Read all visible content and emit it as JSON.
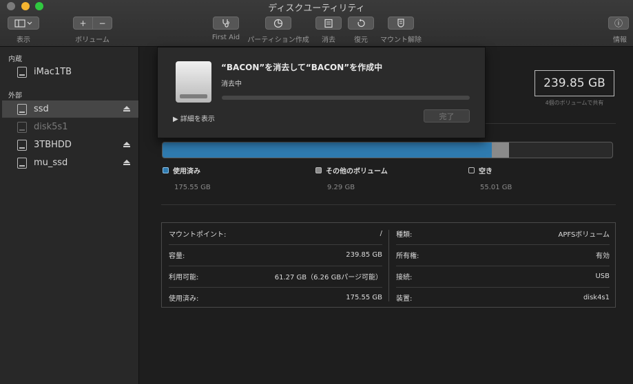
{
  "window": {
    "title": "ディスクユーティリティ"
  },
  "toolbar": {
    "view_label": "表示",
    "volume_label": "ボリューム",
    "volume_add": "+",
    "volume_remove": "−",
    "firstaid_label": "First Aid",
    "partition_label": "パーティション作成",
    "erase_label": "消去",
    "restore_label": "復元",
    "unmount_label": "マウント解除",
    "info_label": "情報",
    "info_glyph": "ⓘ"
  },
  "sidebar": {
    "internal_header": "内蔵",
    "external_header": "外部",
    "internal_items": [
      {
        "label": "iMac1TB"
      }
    ],
    "external_items": [
      {
        "label": "ssd"
      },
      {
        "label": "disk5s1"
      },
      {
        "label": "3TBHDD"
      },
      {
        "label": "mu_ssd"
      }
    ]
  },
  "sheet": {
    "title": "“BACON”を消去して“BACON”を作成中",
    "subtitle": "消去中",
    "progress": 0,
    "details": "▶  詳細を表示",
    "done_button": "完了"
  },
  "capacity": {
    "value": "239.85 GB",
    "shared": "4個のボリュームで共有"
  },
  "usage": {
    "used_fraction": 0.7319,
    "other_fraction": 0.0387,
    "colors": {
      "used": "#2f7bb0",
      "other": "#8a8a8a",
      "free": "#2a2a2a"
    },
    "used_label": "使用済み",
    "used_value": "175.55 GB",
    "other_label": "その他のボリューム",
    "other_value": "9.29 GB",
    "free_label": "空き",
    "free_value": "55.01 GB"
  },
  "info": {
    "left": [
      {
        "key": "マウントポイント:",
        "value": "/"
      },
      {
        "key": "容量:",
        "value": "239.85 GB"
      },
      {
        "key": "利用可能:",
        "value": "61.27 GB（6.26 GBパージ可能）"
      },
      {
        "key": "使用済み:",
        "value": "175.55 GB"
      }
    ],
    "right": [
      {
        "key": "種類:",
        "value": "APFSボリューム"
      },
      {
        "key": "所有権:",
        "value": "有効"
      },
      {
        "key": "接続:",
        "value": "USB"
      },
      {
        "key": "装置:",
        "value": "disk4s1"
      }
    ]
  }
}
